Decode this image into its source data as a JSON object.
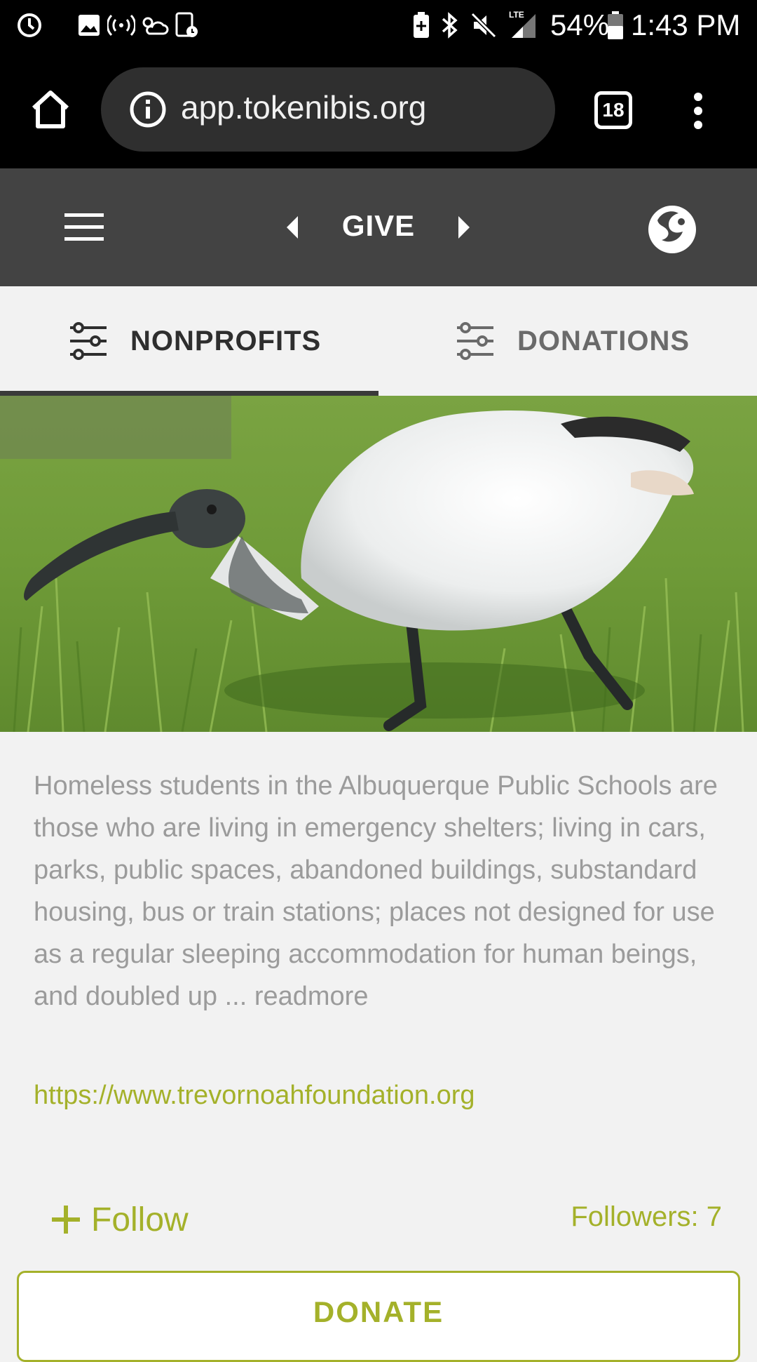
{
  "status_bar": {
    "battery_percent": "54%",
    "time": "1:43 PM",
    "network_label": "LTE",
    "icons": [
      "sync-icon",
      "image-icon",
      "hotspot-icon",
      "weather-icon",
      "screenshot-icon",
      "battery-saver-icon",
      "bluetooth-icon",
      "mute-icon",
      "signal-icon",
      "battery-icon"
    ]
  },
  "browser": {
    "url": "app.tokenibis.org",
    "tab_count": "18",
    "icons": [
      "home-icon",
      "info-icon",
      "more-vert-icon"
    ]
  },
  "app_bar": {
    "title": "GIVE",
    "icons": [
      "hamburger-icon",
      "prev-arrow-icon",
      "next-arrow-icon",
      "ibis-logo-icon"
    ]
  },
  "tabs": [
    {
      "label": "NONPROFITS",
      "active": true,
      "icon": "filter-sliders-icon"
    },
    {
      "label": "DONATIONS",
      "active": false,
      "icon": "filter-sliders-icon"
    }
  ],
  "nonprofit": {
    "image_subject": "white ibis bird on grass",
    "description": "Homeless students in the Albuquerque Public Schools are those who are living in emergency shelters; living in cars, parks, public spaces, abandoned buildings, substandard housing, bus or train stations; places not designed for use as a regular sleeping accommodation for human beings, and doubled up ... readmore",
    "link": "https://www.trevornoahfoundation.org",
    "follow_label": "Follow",
    "followers_text": "Followers: 7",
    "donate_label": "DONATE"
  },
  "colors": {
    "accent": "#a4b12a",
    "app_bar": "#434343",
    "browser_bar": "#000000",
    "background": "#f2f2f2"
  }
}
